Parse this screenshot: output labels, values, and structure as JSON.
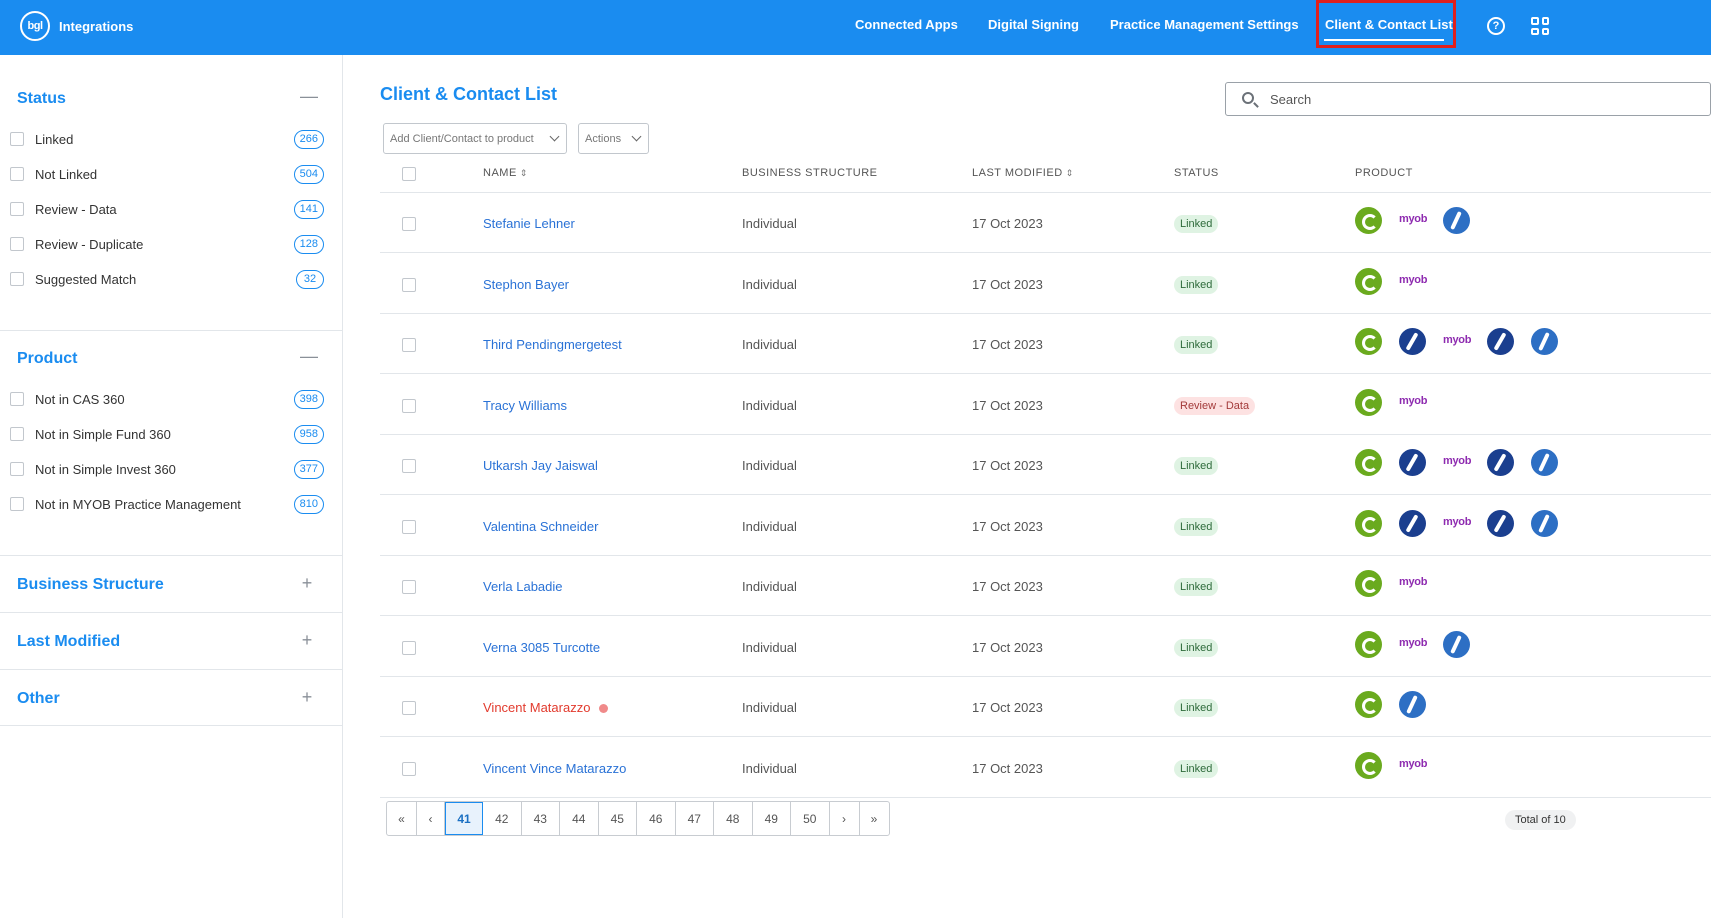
{
  "header": {
    "brand_logo": "bgl",
    "brand_name": "Integrations",
    "nav": [
      {
        "label": "Connected Apps"
      },
      {
        "label": "Digital Signing"
      },
      {
        "label": "Practice Management Settings"
      },
      {
        "label": "Client & Contact List",
        "active": true
      }
    ],
    "help_icon": "?"
  },
  "sidebar": {
    "status": {
      "title": "Status",
      "toggle": "—",
      "items": [
        {
          "label": "Linked",
          "count": "266"
        },
        {
          "label": "Not Linked",
          "count": "504"
        },
        {
          "label": "Review - Data",
          "count": "141"
        },
        {
          "label": "Review - Duplicate",
          "count": "128"
        },
        {
          "label": "Suggested Match",
          "count": "32"
        }
      ]
    },
    "product": {
      "title": "Product",
      "toggle": "—",
      "items": [
        {
          "label": "Not in CAS 360",
          "count": "398"
        },
        {
          "label": "Not in Simple Fund 360",
          "count": "958"
        },
        {
          "label": "Not in Simple Invest 360",
          "count": "377"
        },
        {
          "label": "Not in MYOB Practice Management",
          "count": "810"
        }
      ]
    },
    "collapsed": [
      {
        "title": "Business Structure",
        "toggle": "+"
      },
      {
        "title": "Last Modified",
        "toggle": "+"
      },
      {
        "title": "Other",
        "toggle": "+"
      }
    ]
  },
  "main": {
    "title": "Client & Contact List",
    "search_placeholder": "Search",
    "add_dropdown": "Add Client/Contact to product",
    "actions_dropdown": "Actions",
    "columns": {
      "name": "NAME",
      "structure": "BUSINESS STRUCTURE",
      "modified": "LAST MODIFIED",
      "status": "STATUS",
      "product": "PRODUCT",
      "sort_icon": "⇕"
    },
    "rows": [
      {
        "name": "Stefanie Lehner",
        "structure": "Individual",
        "date": "17 Oct 2023",
        "status": "Linked",
        "status_type": "linked",
        "products": [
          "cas",
          "myob",
          "si"
        ]
      },
      {
        "name": "Stephon Bayer",
        "structure": "Individual",
        "date": "17 Oct 2023",
        "status": "Linked",
        "status_type": "linked",
        "products": [
          "cas",
          "myob"
        ]
      },
      {
        "name": "Third Pendingmergetest",
        "structure": "Individual",
        "date": "17 Oct 2023",
        "status": "Linked",
        "status_type": "linked",
        "products": [
          "cas",
          "sf",
          "myob",
          "sf",
          "si"
        ]
      },
      {
        "name": "Tracy Williams",
        "structure": "Individual",
        "date": "17 Oct 2023",
        "status": "Review - Data",
        "status_type": "review",
        "products": [
          "cas",
          "myob"
        ]
      },
      {
        "name": "Utkarsh Jay Jaiswal",
        "structure": "Individual",
        "date": "17 Oct 2023",
        "status": "Linked",
        "status_type": "linked",
        "products": [
          "cas",
          "sf",
          "myob",
          "sf",
          "si"
        ]
      },
      {
        "name": "Valentina Schneider",
        "structure": "Individual",
        "date": "17 Oct 2023",
        "status": "Linked",
        "status_type": "linked",
        "products": [
          "cas",
          "sf",
          "myob",
          "sf",
          "si"
        ]
      },
      {
        "name": "Verla Labadie",
        "structure": "Individual",
        "date": "17 Oct 2023",
        "status": "Linked",
        "status_type": "linked",
        "products": [
          "cas",
          "myob"
        ]
      },
      {
        "name": "Verna 3085 Turcotte",
        "structure": "Individual",
        "date": "17 Oct 2023",
        "status": "Linked",
        "status_type": "linked",
        "products": [
          "cas",
          "myob",
          "si"
        ]
      },
      {
        "name": "Vincent Matarazzo",
        "structure": "Individual",
        "date": "17 Oct 2023",
        "status": "Linked",
        "status_type": "linked",
        "warning": true,
        "products": [
          "cas",
          "si"
        ]
      },
      {
        "name": "Vincent Vince Matarazzo",
        "structure": "Individual",
        "date": "17 Oct 2023",
        "status": "Linked",
        "status_type": "linked",
        "products": [
          "cas",
          "myob"
        ]
      }
    ],
    "myob_label": "myob",
    "pagination": {
      "first": "«",
      "prev": "‹",
      "pages": [
        "41",
        "42",
        "43",
        "44",
        "45",
        "46",
        "47",
        "48",
        "49",
        "50"
      ],
      "current": "41",
      "next": "›",
      "last": "»"
    },
    "total_text": "Total of 10"
  },
  "colors": {
    "brand_blue": "#1a8cf0",
    "active_outline": "#e0201c",
    "linked_badge": "#dff3e3",
    "review_badge": "#fde2e2",
    "cas_green": "#6aaa1e",
    "simple_fund_navy": "#1b3f8f",
    "myob_purple": "#8e2bb0"
  }
}
